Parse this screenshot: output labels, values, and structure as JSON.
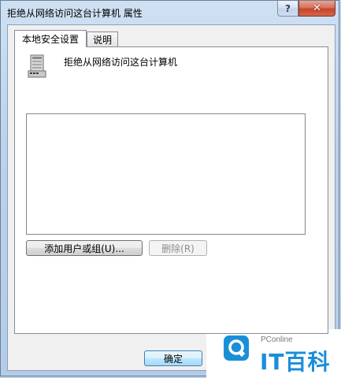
{
  "window": {
    "title": "拒绝从网络访问这台计算机 属性",
    "help_label": "?",
    "close_label": "✕"
  },
  "tabs": [
    {
      "label": "本地安全设置",
      "active": true
    },
    {
      "label": "说明",
      "active": false
    }
  ],
  "policy": {
    "icon": "server-icon",
    "title": "拒绝从网络访问这台计算机"
  },
  "users_list": [],
  "buttons": {
    "add": "添加用户或组(U)...",
    "remove": "删除(R)",
    "ok": "确定"
  },
  "watermark": {
    "brand": "PConline",
    "name": "IT百科",
    "accent": "#1a8fd8"
  }
}
